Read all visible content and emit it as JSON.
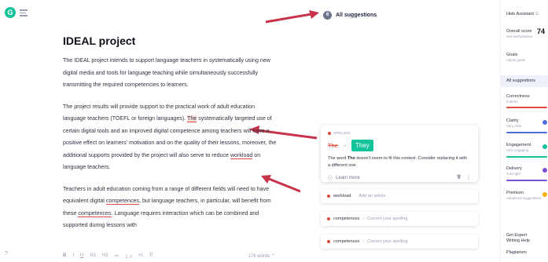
{
  "app": {
    "logo_letter": "G"
  },
  "document": {
    "title": "IDEAL project",
    "p1": "The IDEAL project intends to support language teachers in systematically using new digital media and tools for language teaching while simultaneously successfully transmitting the required competencies to learners.",
    "p2_a": "The project results will provide support to the practical work of adult education language teachers (TOEFL or foreign languages). ",
    "p2_err1": "The",
    "p2_b": " systematically targeted use of certain digital tools and an improved digital competence among teachers will have a positive effect on learners' motivation and on the quality of their lessons, moreover, the additional supports provided by the project will also serve to reduce ",
    "p2_err2": "workload",
    "p2_c": " on language teachers.",
    "p3_a": "Teachers in adult education coming from a range of different fields will need to have equivalent digital ",
    "p3_err1": "competences",
    "p3_b": ", but language teachers, in particular, will benefit from these ",
    "p3_err2": "competences",
    "p3_c": ". Language requires interaction which can be combined and supported during lessons with"
  },
  "toolbar": {
    "bold": "B",
    "italic": "I",
    "underline": "U",
    "h1": "H1",
    "h2": "H2",
    "link": "⚯",
    "ol": "⒈≡",
    "ul": "•≡",
    "clear": "T̸",
    "word_count": "176 words ⌃"
  },
  "help_icon": "?",
  "suggestions_header": {
    "count": "6",
    "label": "All suggestions"
  },
  "active_card": {
    "category": "SPELLING",
    "old": "The",
    "arrow": "→",
    "new": "They",
    "explanation_a": "The word ",
    "explanation_word": "The",
    "explanation_b": " doesn't seem to fit this context. Consider replacing it with a different one.",
    "learn_more": "Learn more",
    "learn_icon": "ⓘ",
    "trash_icon": "🗑",
    "more_icon": "⋮"
  },
  "mini_cards": [
    {
      "word": "workload",
      "sep": "·",
      "desc": "Add an article"
    },
    {
      "word": "competences",
      "sep": "·",
      "desc": "Correct your spelling"
    },
    {
      "word": "competences",
      "sep": "·",
      "desc": "Correct your spelling"
    }
  ],
  "sidebar": {
    "hide_assistant": "Hide Assistant",
    "hide_icon": "☰",
    "overall_score_label": "Overall score",
    "overall_score_value": "74",
    "see_performance": "See performance",
    "goals": "Goals",
    "adjust_goals": "Adjust goals",
    "all_suggestions": "All suggestions",
    "correctness": "Correctness",
    "correctness_sub": "6 alerts",
    "clarity": "Clarity",
    "clarity_sub": "Very clear",
    "engagement": "Engagement",
    "engagement_sub": "Very engaging",
    "delivery": "Delivery",
    "delivery_sub": "Just right",
    "premium": "Premium",
    "premium_sub": "Advanced suggestions",
    "expert_line1": "Get Expert",
    "expert_line2": "Writing Help",
    "plagiarism": "Plagiarism"
  },
  "colors": {
    "accent_green": "#15c39a",
    "error_red": "#e0493f",
    "clarity_blue": "#4a6ee0",
    "engagement_green": "#15c39a",
    "delivery_purple": "#7b4fd1",
    "premium_yellow": "#f5b400",
    "annotation_arrow": "#c8334a"
  }
}
